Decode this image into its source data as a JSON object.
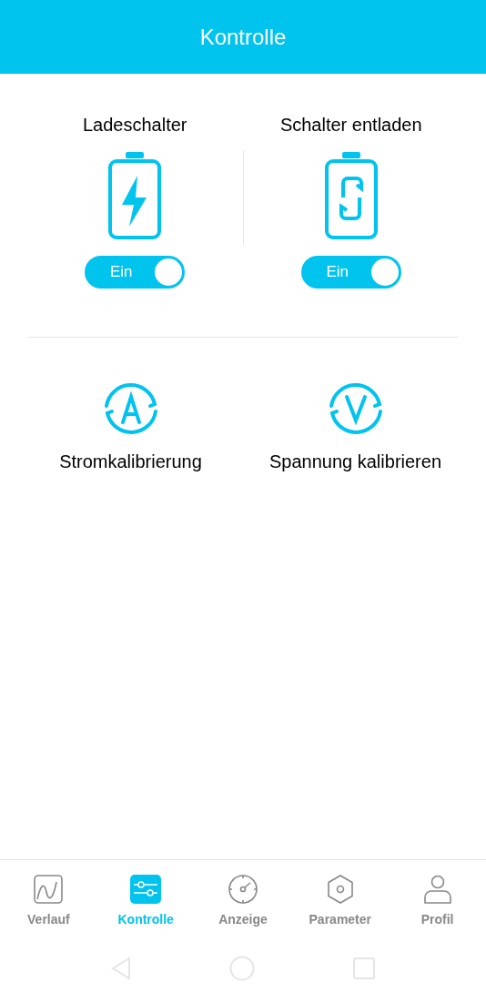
{
  "header": {
    "title": "Kontrolle"
  },
  "switches": [
    {
      "kind": "charge",
      "label": "Ladeschalter",
      "on": true,
      "state_text": "Ein"
    },
    {
      "kind": "discharge",
      "label": "Schalter entladen",
      "on": true,
      "state_text": "Ein"
    }
  ],
  "calibrations": [
    {
      "kind": "current",
      "label": "Stromkalibrierung"
    },
    {
      "kind": "voltage",
      "label": "Spannung kalibrieren"
    }
  ],
  "tabs": [
    {
      "kind": "chart",
      "label": "Verlauf",
      "selected": false
    },
    {
      "kind": "sliders",
      "label": "Kontrolle",
      "selected": true
    },
    {
      "kind": "gauge",
      "label": "Anzeige",
      "selected": false
    },
    {
      "kind": "hexagon",
      "label": "Parameter",
      "selected": false
    },
    {
      "kind": "person",
      "label": "Profil",
      "selected": false
    }
  ]
}
